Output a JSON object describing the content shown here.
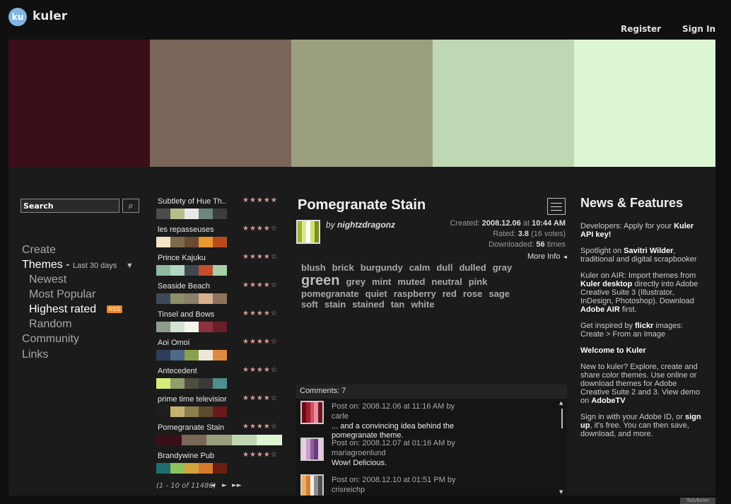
{
  "header": {
    "logo": "ku",
    "brand": "kuler",
    "register": "Register",
    "signin": "Sign In"
  },
  "hero": {
    "colors": [
      "#3b0f19",
      "#7b665a",
      "#9b9f7f",
      "#c0d7b4",
      "#dcf5d3"
    ]
  },
  "search": {
    "value": "Search",
    "icon": "search-grid-icon"
  },
  "nav": {
    "create": "Create",
    "themes": "Themes",
    "themes_sep": "-",
    "themes_range": "Last 30 days",
    "newest": "Newest",
    "popular": "Most Popular",
    "highest": "Highest rated",
    "rss": "RSS",
    "random": "Random",
    "community": "Community",
    "links": "Links"
  },
  "themes": [
    {
      "title": "Subtlety of Hue Th...",
      "stars": "★★★★★",
      "colors": [
        "#4b4b4b",
        "#b5be8a",
        "#e8e8e8",
        "#6e8580",
        "#3c3c3c"
      ]
    },
    {
      "title": "les repasseuses",
      "stars": "★★★★☆",
      "colors": [
        "#f4e4c8",
        "#7c6a4e",
        "#6a4a30",
        "#e6992e",
        "#b94a1e"
      ]
    },
    {
      "title": "Prince Kajuku",
      "stars": "★★★★☆",
      "colors": [
        "#8fbaa2",
        "#b2d8c0",
        "#3e4a4e",
        "#c44e2e",
        "#a8d0a6"
      ]
    },
    {
      "title": "Seaside Beach",
      "stars": "★★★★☆",
      "colors": [
        "#3e4a5a",
        "#8a8e6a",
        "#8c7e68",
        "#d8b08e",
        "#8e745e"
      ]
    },
    {
      "title": "Tinsel and Bows",
      "stars": "★★★★☆",
      "colors": [
        "#8e9e8e",
        "#d4e2d2",
        "#f2f6ee",
        "#8e3240",
        "#6a1e28"
      ]
    },
    {
      "title": "Aoi Omoi",
      "stars": "★★★★☆",
      "colors": [
        "#2e3e5a",
        "#4e6a86",
        "#8aa04e",
        "#eee6d6",
        "#de8a3e"
      ]
    },
    {
      "title": "Antecedent",
      "stars": "★★★★☆",
      "colors": [
        "#d6ec7a",
        "#8e9e6e",
        "#4e4e3e",
        "#3a3a3a",
        "#4e8e8e"
      ]
    },
    {
      "title": "prime time television",
      "stars": "★★★★☆",
      "colors": [
        "#1e1e1e",
        "#c6b26e",
        "#8e7e4e",
        "#5e4a2e",
        "#6a1a1a"
      ]
    },
    {
      "title": "Pomegranate Stain",
      "stars": "★★★★☆",
      "colors": [
        "#3b0f19",
        "#7b665a",
        "#9b9f7f",
        "#c0d7b4",
        "#dcf5d3"
      ]
    },
    {
      "title": "Brandywine Pub",
      "stars": "★★★★☆",
      "colors": [
        "#1e6e6e",
        "#8ec25e",
        "#d2a23e",
        "#d87a2e",
        "#6a1e10"
      ]
    }
  ],
  "pager": {
    "text": "(1 - 10 of 11486)",
    "prev": "◄",
    "next": "►",
    "last": "►►"
  },
  "detail": {
    "title": "Pomegranate Stain",
    "by_prefix": "by",
    "author": "nightzdragonz",
    "thumb_colors": [
      "#a0b030",
      "#dfe88a",
      "#ffffff",
      "#cfe070",
      "#7a8e20"
    ],
    "created_label": "Created:",
    "created": "2008.12.06",
    "created_at": "at",
    "created_time": "10:44 AM",
    "rated_label": "Rated:",
    "rating": "3.8",
    "votes": "(16 votes)",
    "downloaded_label": "Downloaded:",
    "downloads": "56",
    "times": "times",
    "more_info": "More Info",
    "tags": [
      "blush",
      "brick",
      "burgundy",
      "calm",
      "dull",
      "dulled",
      "gray",
      "green",
      "grey",
      "mint",
      "muted",
      "neutral",
      "pink",
      "pomegranate",
      "quiet",
      "raspberry",
      "red",
      "rose",
      "sage",
      "soft",
      "stain",
      "stained",
      "tan",
      "white"
    ]
  },
  "comments": {
    "header": "Comments: 7",
    "items": [
      {
        "meta": "Post on: 2008.12.06 at 11:16 AM by",
        "user": "carle",
        "text": "... and a convincing idea behind the pomegranate theme.",
        "colors": [
          "#6a0a14",
          "#a01e2e",
          "#d24e5e",
          "#e68e9e",
          "#6e1620"
        ]
      },
      {
        "meta": "Post on: 2008.12.07 at 01:16 AM by",
        "user": "mariagroenlund",
        "text": "Wow! Delicious.",
        "colors": [
          "#e8d0e6",
          "#c8a0c8",
          "#8e5e9e",
          "#6a3e7e",
          "#e6c8e0"
        ]
      },
      {
        "meta": "Post on: 2008.12.10 at 01:51 PM by",
        "user": "crisreichp",
        "text": "",
        "colors": [
          "#e6b06e",
          "#d87e2e",
          "#f2f2f2",
          "#8e8e8e",
          "#4e4e4e"
        ]
      }
    ]
  },
  "news": {
    "title": "News & Features",
    "p1a": "Developers: Apply for your",
    "p1b": "Kuler API key!",
    "p2a": "Spotlight on",
    "p2b": "Savitri Wilder",
    "p2c": ", traditional and digital scrapbooker",
    "p3a": "Kuler on AIR: Import themes from",
    "p3b": "Kuler desktop",
    "p3c": "directly into Adobe Creative Suite 3 (Illustrator, InDesign, Photoshop). Download",
    "p3d": "Adobe AIR",
    "p3e": "first.",
    "p4a": "Get inspired by",
    "p4b": "flickr",
    "p4c": "images: Create > From an Image",
    "p5": "Welcome to Kuler",
    "p6a": "New to kuler? Explore, create and share color themes. Use online or download themes for Adobe Creative Suite 2 and 3. View demo on",
    "p6b": "AdobeTV",
    "p7a": "Sign in with your Adobe ID, or",
    "p7b": "sign up",
    "p7c": ", it's free. You can then save, download, and more."
  },
  "footer": {
    "badge": "Tab/Kuler"
  }
}
